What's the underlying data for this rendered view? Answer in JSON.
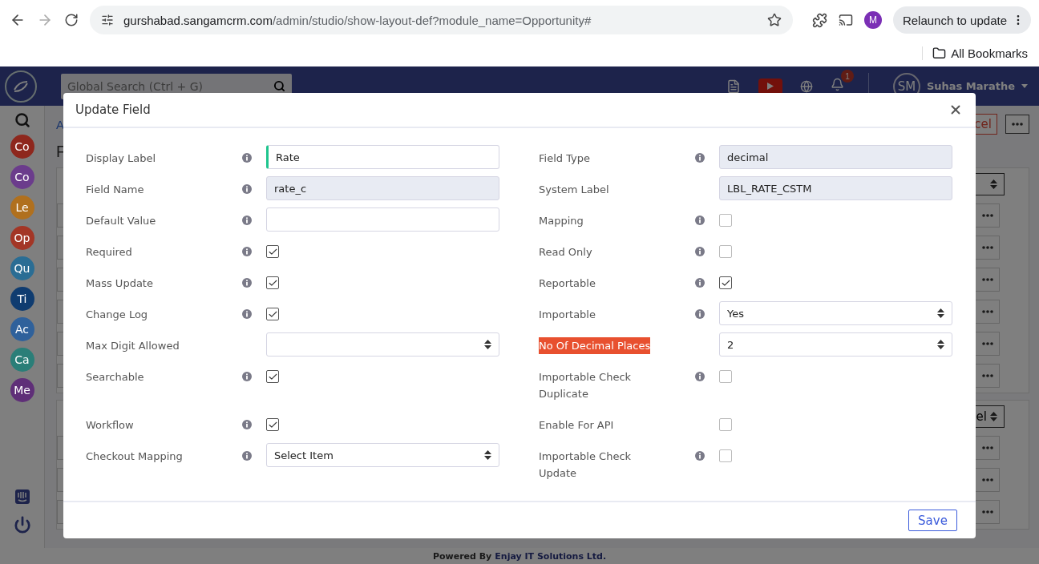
{
  "browser": {
    "url_host": "gurshabad.sangamcrm.com",
    "url_path": "/admin/studio/show-layout-def?module_name=Opportunity#",
    "profile_initial": "M",
    "relaunch_label": "Relaunch to update",
    "bookmarks_label": "All Bookmarks"
  },
  "header": {
    "search_placeholder": "Global Search (Ctrl + G)",
    "notification_count": "1",
    "user_initials": "SM",
    "user_name": "Suhas Marathe"
  },
  "sidebar": {
    "modules": [
      {
        "label": "Co",
        "color": "#8e271d"
      },
      {
        "label": "Co",
        "color": "#6b3c8c"
      },
      {
        "label": "Le",
        "color": "#b0701e"
      },
      {
        "label": "Op",
        "color": "#a33626"
      },
      {
        "label": "Qu",
        "color": "#2a6d94"
      },
      {
        "label": "Ti",
        "color": "#0f3c70"
      },
      {
        "label": "Ac",
        "color": "#2f619b"
      },
      {
        "label": "Ca",
        "color": "#2a7e78"
      },
      {
        "label": "Me",
        "color": "#5f2f78"
      }
    ]
  },
  "background": {
    "breadcrumb": "A",
    "page_title": "F",
    "cancel_fragment": "cel",
    "select_fragment": "el"
  },
  "dialog": {
    "title": "Update Field",
    "save_label": "Save",
    "left_fields": [
      {
        "label": "Display Label",
        "info": true,
        "highlighted": false,
        "kind": "text",
        "value": "Rate",
        "focused": true
      },
      {
        "label": "Field Name",
        "info": true,
        "highlighted": false,
        "kind": "readonly",
        "value": "rate_c"
      },
      {
        "label": "Default Value",
        "info": true,
        "highlighted": false,
        "kind": "text",
        "focused": false
      },
      {
        "label": "Required",
        "info": true,
        "highlighted": false,
        "kind": "checkbox",
        "checked": true
      },
      {
        "label": "Mass Update",
        "info": true,
        "highlighted": false,
        "kind": "checkbox",
        "checked": true
      },
      {
        "label": "Change Log",
        "info": true,
        "highlighted": false,
        "kind": "checkbox",
        "checked": true
      },
      {
        "label": "Max Digit Allowed",
        "info": false,
        "highlighted": false,
        "kind": "select"
      },
      {
        "label": "Searchable",
        "info": true,
        "highlighted": false,
        "kind": "checkbox",
        "checked": true
      },
      {
        "label": "Workflow",
        "info": true,
        "highlighted": false,
        "kind": "checkbox",
        "checked": true
      },
      {
        "label": "Checkout Mapping",
        "info": true,
        "highlighted": false,
        "kind": "select",
        "value": "Select Item"
      }
    ],
    "right_fields": [
      {
        "label": "Field Type",
        "info": true,
        "highlighted": false,
        "kind": "readonly",
        "value": "decimal"
      },
      {
        "label": "System Label",
        "info": false,
        "highlighted": false,
        "kind": "readonly",
        "value": "LBL_RATE_CSTM"
      },
      {
        "label": "Mapping",
        "info": true,
        "highlighted": false,
        "kind": "checkbox",
        "checked": false
      },
      {
        "label": "Read Only",
        "info": true,
        "highlighted": false,
        "kind": "checkbox",
        "checked": false
      },
      {
        "label": "Reportable",
        "info": true,
        "highlighted": false,
        "kind": "checkbox",
        "checked": true
      },
      {
        "label": "Importable",
        "info": true,
        "highlighted": false,
        "kind": "select",
        "value": "Yes"
      },
      {
        "label": "No Of Decimal Places",
        "info": false,
        "highlighted": true,
        "kind": "select",
        "value": "2"
      },
      {
        "label": "Importable Check Duplicate",
        "info": true,
        "highlighted": false,
        "kind": "checkbox",
        "checked": false
      },
      {
        "label": "Enable For API",
        "info": false,
        "highlighted": false,
        "kind": "checkbox",
        "checked": false
      },
      {
        "label": "Importable Check Update",
        "info": true,
        "highlighted": false,
        "kind": "checkbox",
        "checked": false
      }
    ]
  },
  "footer": {
    "prefix": "Powered By",
    "company": "Enjay IT Solutions Ltd."
  }
}
